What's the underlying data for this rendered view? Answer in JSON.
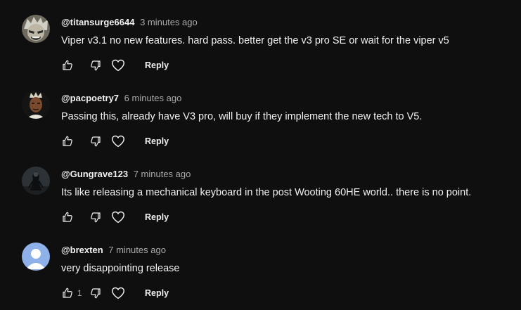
{
  "comments": [
    {
      "author": "@titansurge6644",
      "time": "3 minutes ago",
      "text": "Viper v3.1 no new features. hard pass. better get the v3 pro SE or wait for the viper v5",
      "like_count": "",
      "reply_label": "Reply",
      "avatar": "anime-character-avatar"
    },
    {
      "author": "@pacpoetry7",
      "time": "6 minutes ago",
      "text": "Passing this, already have V3 pro, will buy if they implement the new tech to V5.",
      "like_count": "",
      "reply_label": "Reply",
      "avatar": "crowned-portrait-avatar"
    },
    {
      "author": "@Gungrave123",
      "time": "7 minutes ago",
      "text": "Its like releasing a mechanical keyboard in the post Wooting 60HE world.. there is no point.",
      "like_count": "",
      "reply_label": "Reply",
      "avatar": "dark-figure-avatar"
    },
    {
      "author": "@brexten",
      "time": "7 minutes ago",
      "text": "very disappointing release",
      "like_count": "1",
      "reply_label": "Reply",
      "avatar": "default-person-avatar"
    }
  ],
  "icons": {
    "like": "thumbs-up-icon",
    "dislike": "thumbs-down-icon",
    "heart": "heart-icon"
  },
  "colors": {
    "background": "#0f0f0f",
    "text_primary": "#f1f1f1",
    "text_secondary": "#aaaaaa",
    "default_avatar": "#8eb1ea"
  }
}
